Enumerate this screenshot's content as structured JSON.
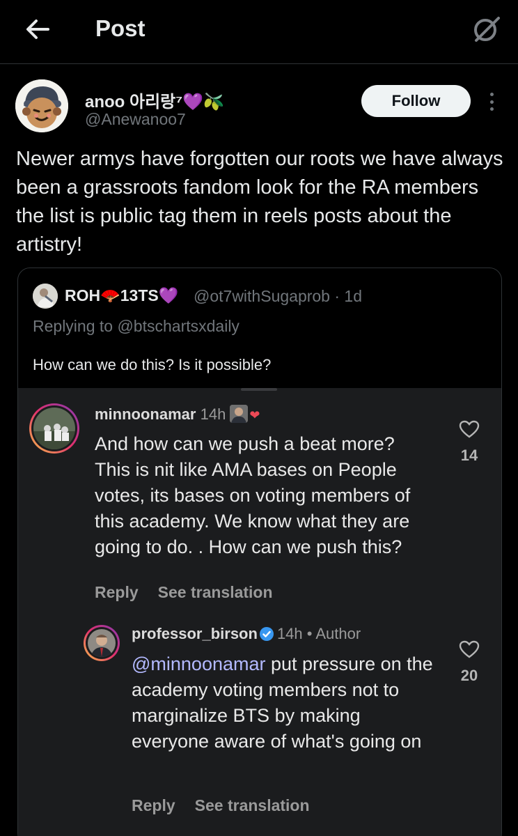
{
  "header": {
    "title": "Post",
    "back_icon": "arrow-left-icon",
    "grok_icon": "grok-icon"
  },
  "author": {
    "display_name": "anoo 아리랑⁷",
    "emojis": "💜🫒",
    "handle": "@Anewanoo7",
    "follow_label": "Follow"
  },
  "post": {
    "text": "Newer armys have forgotten our roots we have always been a grassroots fandom look for the RA members the list is public tag them in reels posts about the artistry!"
  },
  "quote": {
    "name_prefix": "ROH",
    "name_suffix": "13TS",
    "name_emoji_1": "🪭",
    "name_emoji_2": "💜",
    "handle_time": "@ot7withSugaprob · 1d",
    "replying": "Replying to @btschartsxdaily",
    "text": "How can we do this? Is it possible?"
  },
  "screenshot": {
    "comments": [
      {
        "username": "minnoonamar",
        "time": "14h",
        "body": "And how can we push a beat more? This is nit like AMA bases on People votes, its bases on voting members of this academy. We know what they are going to do. . How can we push this?",
        "reply_label": "Reply",
        "translate_label": "See translation",
        "likes": "14"
      },
      {
        "username": "professor_birson",
        "time": "14h • Author",
        "mention": "@minnoonamar",
        "body": " put pressure on the academy voting members not to marginalize BTS by making everyone aware of what's going on",
        "reply_label": "Reply",
        "translate_label": "See translation",
        "likes": "20"
      }
    ]
  },
  "colors": {
    "background": "#000000",
    "text": "#e7e9ea",
    "muted": "#71767b",
    "border": "#2f3336",
    "follow_bg": "#eff3f4",
    "mention": "#b3b9ff"
  }
}
